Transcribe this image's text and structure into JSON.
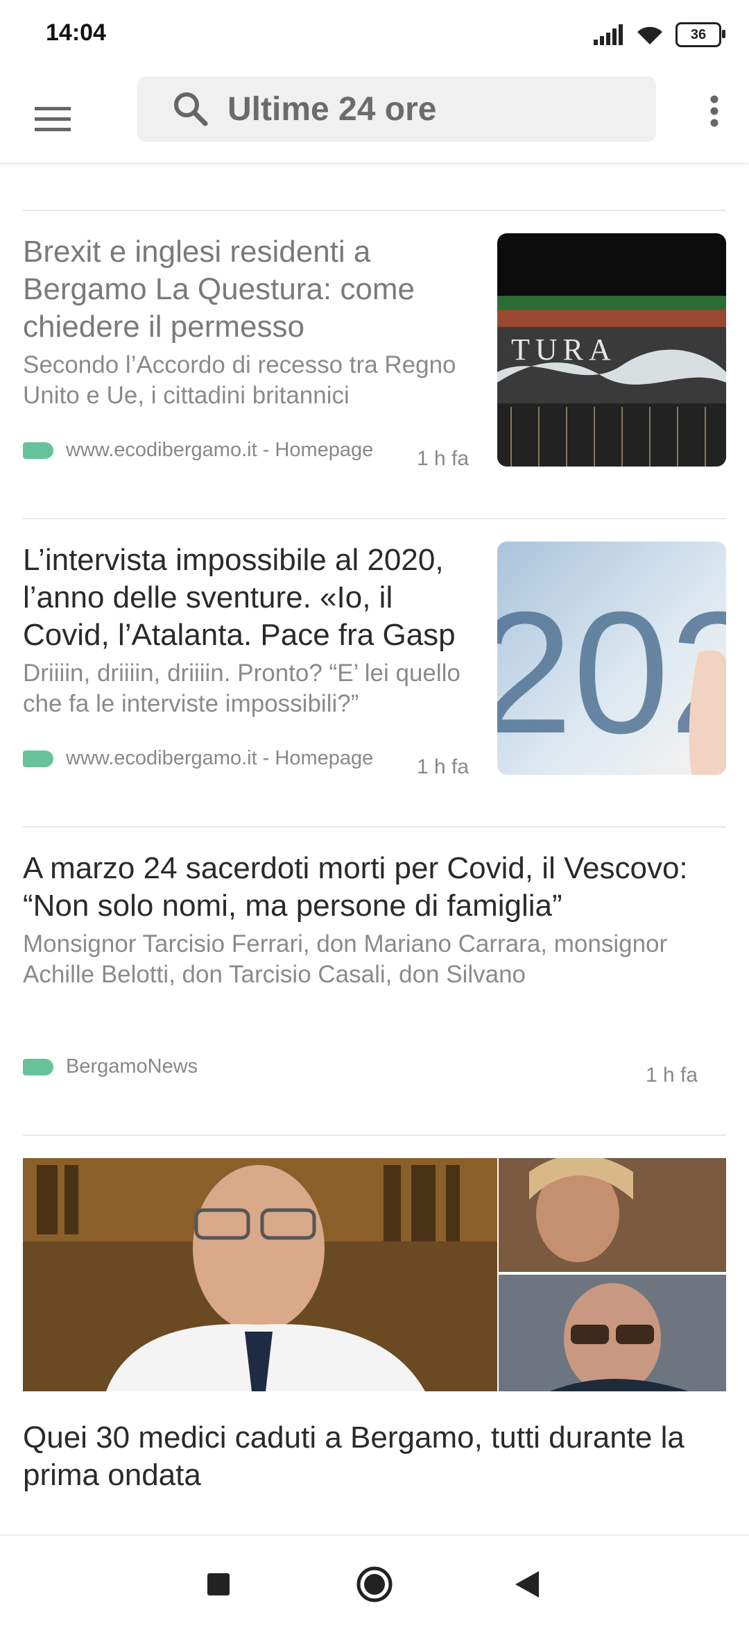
{
  "status": {
    "time": "14:04",
    "battery": "36"
  },
  "search": {
    "placeholder": "Ultime 24 ore"
  },
  "articles": [
    {
      "title": "Brexit e inglesi residenti a Bergamo La Questura: come chiedere il permesso",
      "snippet": "Secondo l’Accordo di recesso tra Regno Unito e Ue, i cittadini britannici",
      "source": "www.ecodibergamo.it - Homepage",
      "time": "1 h fa",
      "image_caption": "TURA"
    },
    {
      "title": "L’intervista impossibile al 2020, l’anno delle sventure. «Io, il Covid, l’Atalanta. Pace fra Gasp",
      "snippet": "Driiiin, driiiin, driiiin. Pronto? “E’ lei quello che fa le interviste impossibili?”",
      "source": "www.ecodibergamo.it - Homepage",
      "time": "1 h fa",
      "image_caption": "202"
    },
    {
      "title": "A marzo 24 sacerdoti morti per Covid, il Vescovo: “Non solo nomi, ma persone di famiglia”",
      "snippet": "Monsignor Tarcisio Ferrari, don Mariano Carrara, monsignor Achille Belotti, don Tarcisio Casali, don Silvano",
      "source": "BergamoNews",
      "time": "1 h fa"
    },
    {
      "title": "Quei 30 medici caduti a Bergamo, tutti durante la prima ondata"
    }
  ],
  "colors": {
    "tag": "#67c29a",
    "accent": "#6b6b6b"
  }
}
